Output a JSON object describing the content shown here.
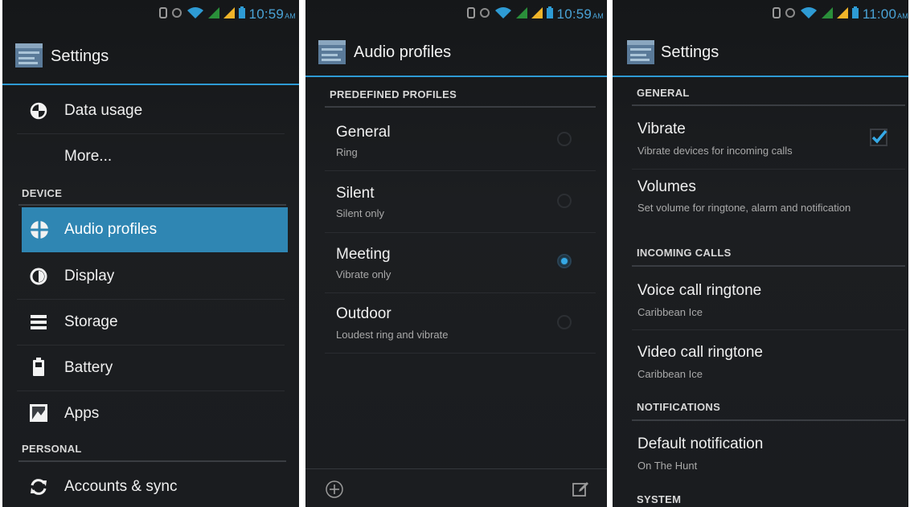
{
  "panel1": {
    "status": {
      "time": "10:59",
      "ampm": "AM"
    },
    "title": "Settings",
    "items": [
      {
        "label": "Data usage",
        "icon": "data-usage-icon"
      },
      {
        "label": "More..."
      }
    ],
    "section_device": "DEVICE",
    "device_items": [
      {
        "label": "Audio profiles",
        "icon": "audio-profiles-icon",
        "selected": true
      },
      {
        "label": "Display",
        "icon": "display-icon"
      },
      {
        "label": "Storage",
        "icon": "storage-icon"
      },
      {
        "label": "Battery",
        "icon": "battery-icon"
      },
      {
        "label": "Apps",
        "icon": "apps-icon"
      }
    ],
    "section_personal": "PERSONAL",
    "personal_items": [
      {
        "label": "Accounts & sync",
        "icon": "sync-icon"
      }
    ]
  },
  "panel2": {
    "status": {
      "time": "10:59",
      "ampm": "AM"
    },
    "title": "Audio profiles",
    "section": "PREDEFINED PROFILES",
    "profiles": [
      {
        "name": "General",
        "desc": "Ring",
        "selected": false
      },
      {
        "name": "Silent",
        "desc": "Silent only",
        "selected": false
      },
      {
        "name": "Meeting",
        "desc": "Vibrate only",
        "selected": true
      },
      {
        "name": "Outdoor",
        "desc": "Loudest ring and vibrate",
        "selected": false
      }
    ]
  },
  "panel3": {
    "status": {
      "time": "11:00",
      "ampm": "AM"
    },
    "title": "Settings",
    "section_general": "GENERAL",
    "vibrate": {
      "title": "Vibrate",
      "desc": "Vibrate devices for incoming calls",
      "checked": true
    },
    "volumes": {
      "title": "Volumes",
      "desc": "Set volume for ringtone, alarm and notification"
    },
    "section_incoming": "INCOMING CALLS",
    "voice": {
      "title": "Voice call ringtone",
      "desc": "Caribbean Ice"
    },
    "video": {
      "title": "Video call ringtone",
      "desc": "Caribbean Ice"
    },
    "section_notifications": "NOTIFICATIONS",
    "notification": {
      "title": "Default notification",
      "desc": "On The Hunt"
    },
    "section_system": "SYSTEM"
  },
  "colors": {
    "accent": "#2e9bd4",
    "selected_row": "#2f86b3",
    "status_time": "#4aa3d6",
    "signal": "#f0b429"
  }
}
